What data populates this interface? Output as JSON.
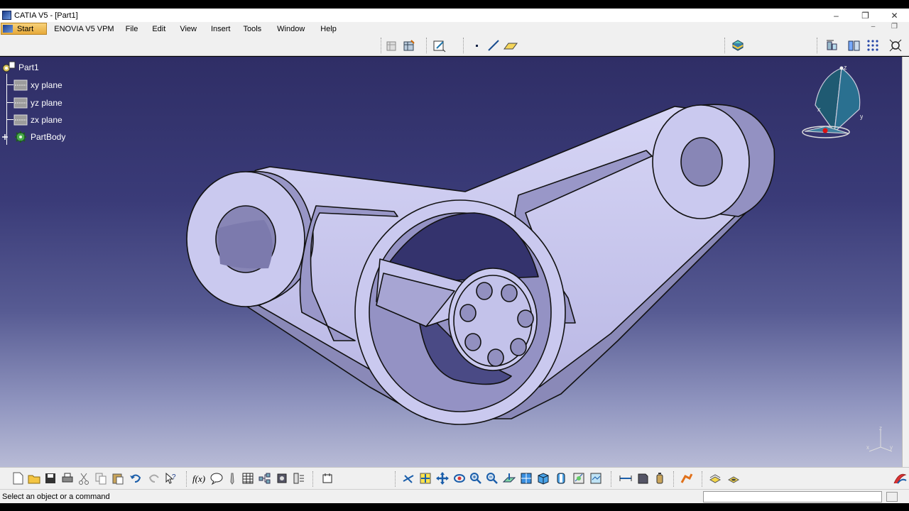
{
  "window": {
    "title": "CATIA V5 - [Part1]",
    "minimize_glyph": "–",
    "restore_glyph": "❐",
    "close_glyph": "✕"
  },
  "menubar": {
    "start": "Start",
    "items": [
      "ENOVIA V5 VPM",
      "File",
      "Edit",
      "View",
      "Insert",
      "Tools",
      "Window",
      "Help"
    ],
    "doc_controls": "– ❐"
  },
  "tree": {
    "root": "Part1",
    "children": [
      "xy plane",
      "yz plane",
      "zx plane"
    ],
    "body": "PartBody"
  },
  "compass": {
    "x": "x",
    "y": "y",
    "z": "z"
  },
  "axis_triad": {
    "x": "x",
    "y": "y",
    "z": "z"
  },
  "status": {
    "message": "Select an object or a command",
    "command_value": ""
  },
  "toolbar_top_icons": [
    "sketch-grid-icon",
    "sketcher-icon",
    "point-icon",
    "line-icon",
    "plane-icon",
    "apply-material-icon",
    "measure-icon",
    "inertia-icon",
    "grid-icon",
    "zoom-fit-icon"
  ],
  "toolbar_bottom_icons": [
    "new-icon",
    "open-icon",
    "save-icon",
    "print-icon",
    "cut-icon",
    "copy-icon",
    "paste-icon",
    "undo-icon",
    "redo-icon",
    "whats-this-icon",
    "formula-icon",
    "comment-icon",
    "design-table-icon",
    "catalog-icon",
    "fly-mode-icon",
    "pan-icon",
    "rotate-icon",
    "zoom-in-icon",
    "zoom-out-icon",
    "normal-view-icon",
    "multi-view-icon",
    "iso-view-icon",
    "shading-icon",
    "hide-show-icon",
    "swap-visible-icon",
    "render-style-icon",
    "analysis-icon",
    "mass-icon",
    "apply-icon",
    "knowledge-icon",
    "hole-icon"
  ],
  "colors": {
    "viewport_top": "#2f2e66",
    "viewport_bottom": "#b8bbd6",
    "part_face": "#c9c8ee",
    "part_shadow": "#8c8ab9",
    "part_edge": "#111111",
    "compass_fill": "#1f5a72"
  }
}
